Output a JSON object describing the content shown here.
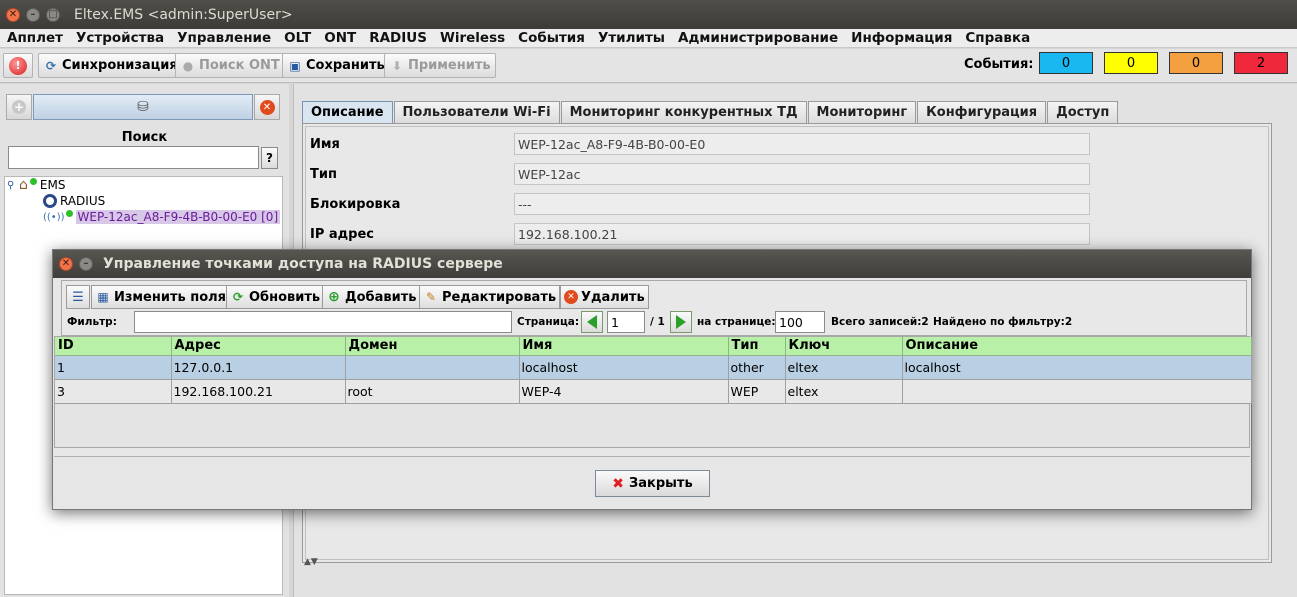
{
  "window": {
    "title": "Eltex.EMS <admin:SuperUser>"
  },
  "menu": [
    "Апплет",
    "Устройства",
    "Управление",
    "OLT",
    "ONT",
    "RADIUS",
    "Wireless",
    "События",
    "Утилиты",
    "Администрирование",
    "Информация",
    "Справка"
  ],
  "toolbar": {
    "sync": "Синхронизация",
    "search_ont": "Поиск ONT",
    "save": "Сохранить",
    "apply": "Применить",
    "events_label": "События:",
    "events": [
      {
        "value": "0",
        "color": "#19b8f0"
      },
      {
        "value": "0",
        "color": "#ffff00"
      },
      {
        "value": "0",
        "color": "#f5a040"
      },
      {
        "value": "2",
        "color": "#f0283c"
      }
    ]
  },
  "left": {
    "search_label": "Поиск",
    "search_help": "?",
    "tree": {
      "root": "EMS",
      "radius": "RADIUS",
      "device": "WEP-12ac_A8-F9-4B-B0-00-E0 [0]"
    }
  },
  "tabs": [
    "Описание",
    "Пользователи Wi-Fi",
    "Мониторинг конкурентных ТД",
    "Мониторинг",
    "Конфигурация",
    "Доступ"
  ],
  "fields": [
    {
      "label": "Имя",
      "value": "WEP-12ac_A8-F9-4B-B0-00-E0"
    },
    {
      "label": "Тип",
      "value": "WEP-12ac"
    },
    {
      "label": "Блокировка",
      "value": "---"
    },
    {
      "label": "IP адрес",
      "value": "192.168.100.21"
    }
  ],
  "dialog": {
    "title": "Управление точками доступа на RADIUS сервере",
    "buttons": {
      "edit_fields": "Изменить поля",
      "refresh": "Обновить",
      "add": "Добавить",
      "edit": "Редактировать",
      "delete": "Удалить"
    },
    "filter_label": "Фильтр:",
    "filter_value": "",
    "page_label": "Страница:",
    "page_value": "1",
    "page_total": "/ 1",
    "per_page_label": "на странице:",
    "per_page_value": "100",
    "total": "Всего записей:2",
    "found": "Найдено по фильтру:2",
    "columns": [
      "ID",
      "Адрес",
      "Домен",
      "Имя",
      "Тип",
      "Ключ",
      "Описание"
    ],
    "rows": [
      [
        "1",
        "127.0.0.1",
        "",
        "localhost",
        "other",
        "eltex",
        "localhost"
      ],
      [
        "3",
        "192.168.100.21",
        "root",
        "WEP-4",
        "WEP",
        "eltex",
        ""
      ]
    ],
    "close": "Закрыть"
  }
}
